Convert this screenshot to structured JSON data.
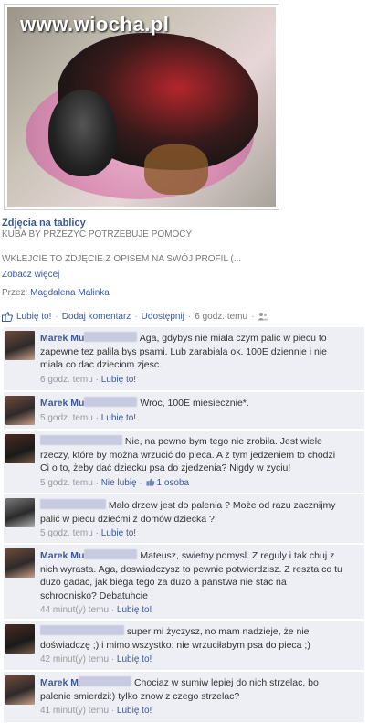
{
  "photo": {
    "watermark": "www.wiocha.pl"
  },
  "post": {
    "title": "Zdjęcia na tablicy",
    "subtitle": "KUBA BY PRZEŻYĆ POTRZEBUJE POMOCY",
    "description": "WKLEJCIE TO ZDJĘCIE Z OPISEM NA SWÓJ PROFIL (...",
    "see_more": "Zobacz więcej",
    "via_label": "Przez:",
    "via_name": "Magdalena Malinka"
  },
  "actions": {
    "like": "Lubię to!",
    "comment": "Dodaj komentarz",
    "share": "Udostępnij",
    "time": "6 godz. temu"
  },
  "comments": [
    {
      "author": "Marek Mu",
      "text": "Aga, gdybys nie miala czym palic w piecu to zapewne tez palila bys psami. Lub zarabiala ok. 100E dziennie i nie miala co dac dzieciom zjesc.",
      "time": "6 godz. temu",
      "like": "Lubię to!"
    },
    {
      "author": "Marek Mu",
      "text": "Wroc, 100E miesiecznie*.",
      "time": "5 godz. temu",
      "like": "Lubię to!"
    },
    {
      "author": "",
      "text": "Nie, na pewno bym tego nie zrobiła. Jest wiele rzeczy, które by można wrzucić do pieca. A z tym jedzeniem to chodzi Ci o to, żeby dać dziecku psa do zjedzenia? Nigdy w zyciu!",
      "time": "5 godz. temu",
      "like": "Nie lubię",
      "likes_count": "1 osoba"
    },
    {
      "author": "",
      "text": "Mało drzew jest do palenia ? Może od razu zacznijmy palić w piecu dziećmi z domów dziecka ?",
      "time": "5 godz. temu",
      "like": "Lubię to!"
    },
    {
      "author": "Marek Mu",
      "text": "Mateusz, swietny pomysl. Z reguly i tak chuj z nich wyrasta. Aga, doswiadczysz to pewnie potwierdzisz. Z reszta co tu duzo gadac, jak biega tego za duzo a panstwa nie stac na schroonisko? Debatuhcie",
      "time": "44 minut(y) temu",
      "like": "Lubię to!"
    },
    {
      "author": "",
      "text": "super mi życzysz, no mam nadzieje, że nie doświadczę ;) i mimo wszystko: nie wrzuciłabym psa do pieca ;)",
      "time": "42 minut(y) temu",
      "like": "Lubię to!"
    },
    {
      "author": "Marek M",
      "text": "Chociaz w sumiw lepiej do nich strzelac, bo palenie smierdzi:) tylko znow z czego strzelac?",
      "time": "41 minut(y) temu",
      "like": "Lubię to!"
    }
  ]
}
